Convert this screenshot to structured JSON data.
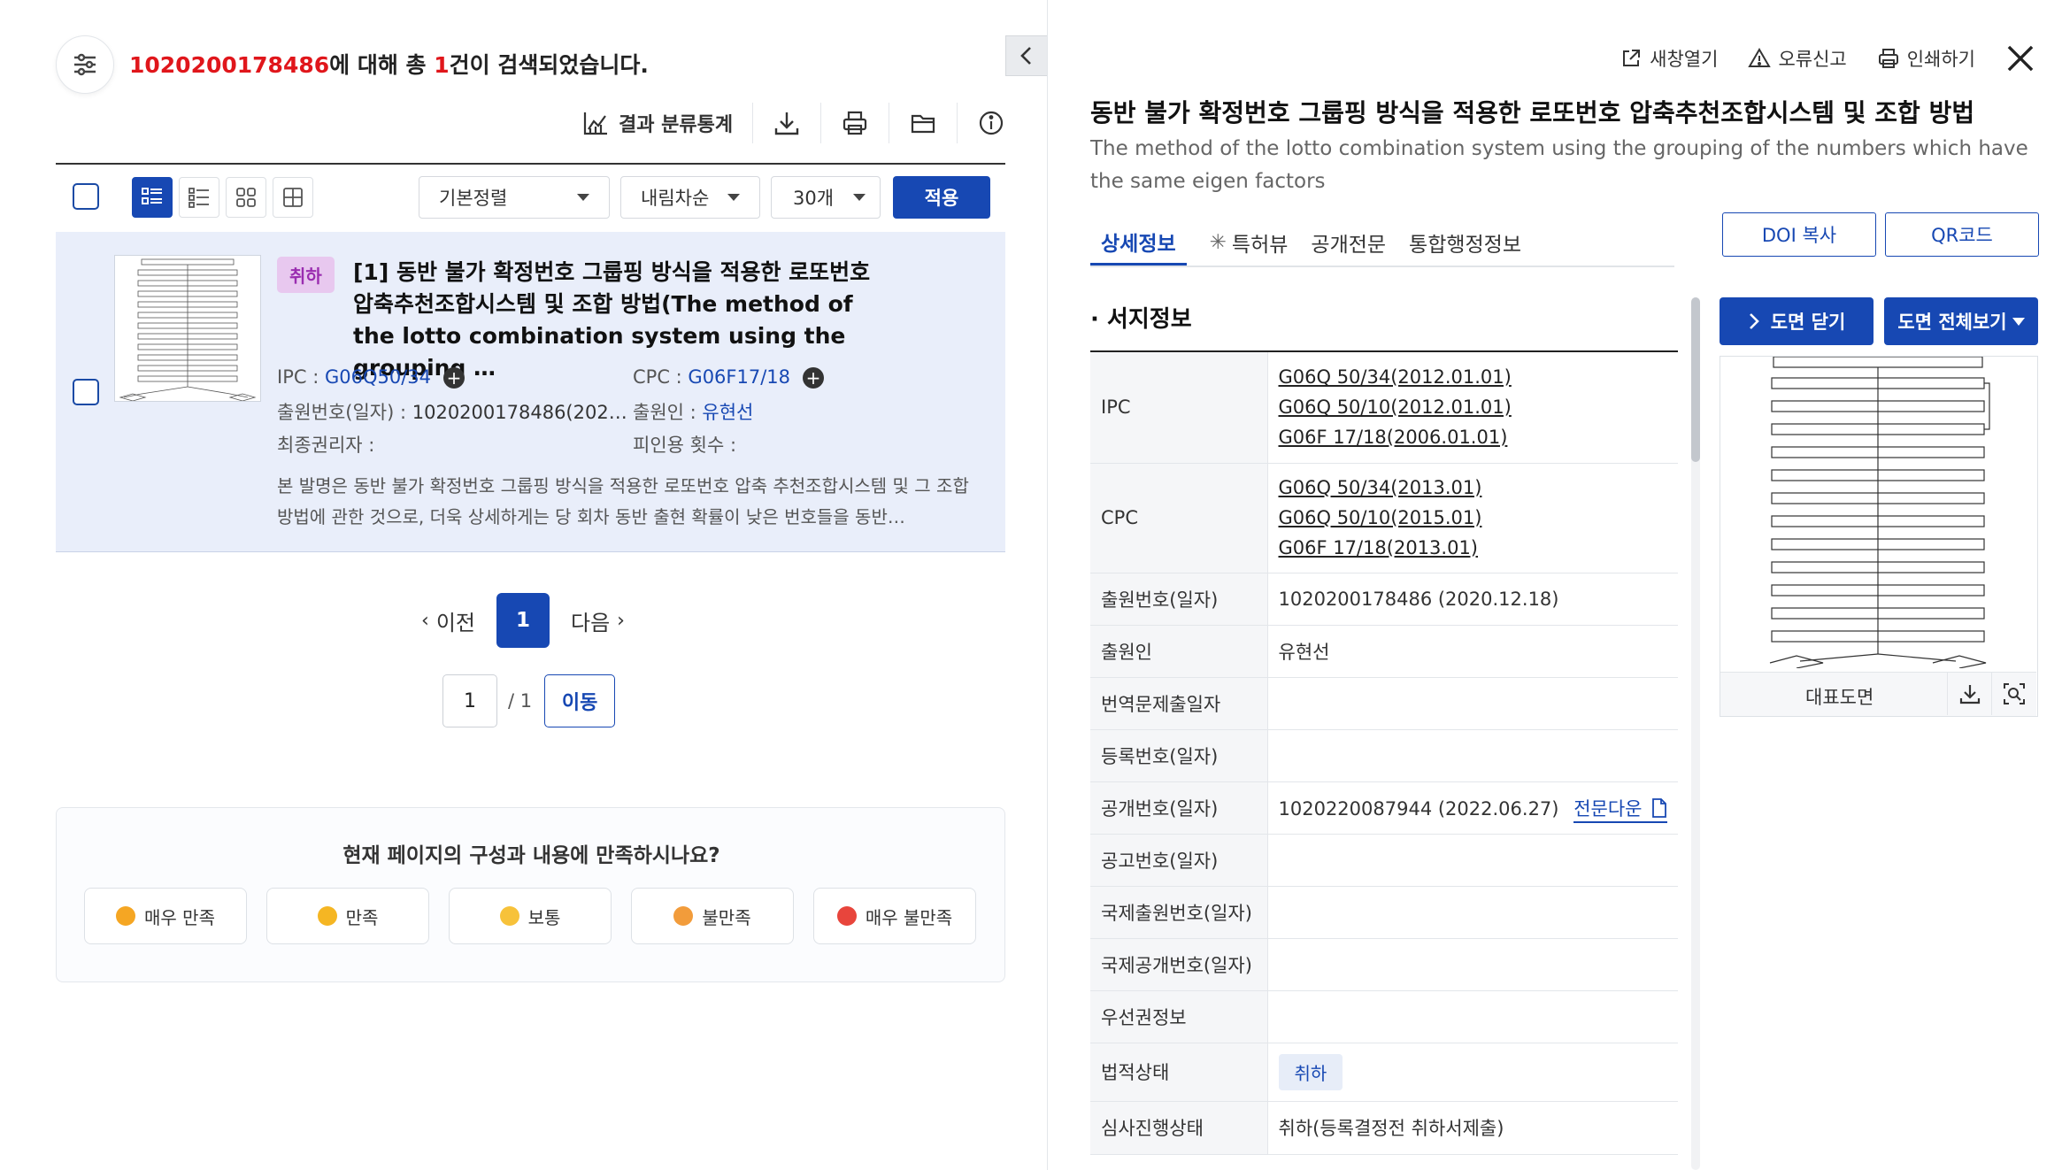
{
  "search": {
    "query": "1020200178486",
    "prefix": "에 대해 총 ",
    "count": "1",
    "suffix": "건이 검색되었습니다."
  },
  "toolbar": {
    "stats_label": "결과 분류통계"
  },
  "list_controls": {
    "sort_value": "기본정렬",
    "order_value": "내림차순",
    "page_size_value": "30개",
    "apply_label": "적용"
  },
  "result": {
    "status_badge": "취하",
    "title": "[1] 동반 불가 확정번호 그룹핑 방식을 적용한 로또번호 압축추천조합시스템 및 조합 방법(The method of the lotto combination system using the grouping …",
    "ipc_label": "IPC : ",
    "ipc_value": "G06Q50/34",
    "cpc_label": "CPC : ",
    "cpc_value": "G06F17/18",
    "app_no_label": "출원번호(일자) : ",
    "app_no_value": "1020200178486(202…",
    "applicant_label": "출원인 : ",
    "applicant_value": "유현선",
    "final_holder_label": "최종권리자 : ",
    "citation_label": "피인용 횟수 : ",
    "abstract": "본 발명은 동반 불가 확정번호 그룹핑 방식을 적용한 로또번호 압축 추천조합시스템 및 그 조합 방법에 관한 것으로, 더욱 상세하게는 당 회차 동반 출현 확률이 낮은 번호들을 동반…"
  },
  "pagination": {
    "prev_label": "이전",
    "current_page": "1",
    "next_label": "다음",
    "page_input_value": "1",
    "total_pages": "/ 1",
    "goto_label": "이동"
  },
  "survey": {
    "question": "현재 페이지의 구성과 내용에 만족하시나요?",
    "options": [
      "매우 만족",
      "만족",
      "보통",
      "불만족",
      "매우 불만족"
    ],
    "option_colors": [
      "#f5a623",
      "#f5b623",
      "#f7c23a",
      "#f29c3b",
      "#e8453c"
    ]
  },
  "detail": {
    "actions": {
      "new_window": "새창열기",
      "report_error": "오류신고",
      "print": "인쇄하기"
    },
    "title": "동반 불가 확정번호 그룹핑 방식을 적용한 로또번호 압축추천조합시스템 및 조합 방법",
    "subtitle": "The method of the lotto combination system using the grouping of the numbers which have the same eigen factors",
    "tabs": [
      "상세정보",
      "특허뷰",
      "공개전문",
      "통합행정정보"
    ],
    "doi_copy_label": "DOI 복사",
    "qr_label": "QR코드",
    "section_title": "· 서지정보",
    "rows": {
      "ipc_key": "IPC",
      "ipc_values": [
        "G06Q 50/34(2012.01.01)",
        "G06Q 50/10(2012.01.01)",
        "G06F 17/18(2006.01.01)"
      ],
      "cpc_key": "CPC",
      "cpc_values": [
        "G06Q 50/34(2013.01)",
        "G06Q 50/10(2015.01)",
        "G06F 17/18(2013.01)"
      ],
      "app_key": "출원번호(일자)",
      "app_value": "1020200178486 (2020.12.18)",
      "applicant_key": "출원인",
      "applicant_value": "유현선",
      "translation_key": "번역문제출일자",
      "registration_key": "등록번호(일자)",
      "publication_key": "공개번호(일자)",
      "publication_value": "1020220087944 (2022.06.27)",
      "fulltext_download": "전문다운",
      "announcement_key": "공고번호(일자)",
      "intl_app_key": "국제출원번호(일자)",
      "intl_pub_key": "국제공개번호(일자)",
      "priority_key": "우선권정보",
      "legal_status_key": "법적상태",
      "legal_status_value": "취하",
      "exam_status_key": "심사진행상태",
      "exam_status_value": "취하(등록결정전 취하서제출)"
    },
    "drawing": {
      "close_label": "도면 닫기",
      "view_all_label": "도면 전체보기",
      "caption": "대표도면"
    }
  }
}
